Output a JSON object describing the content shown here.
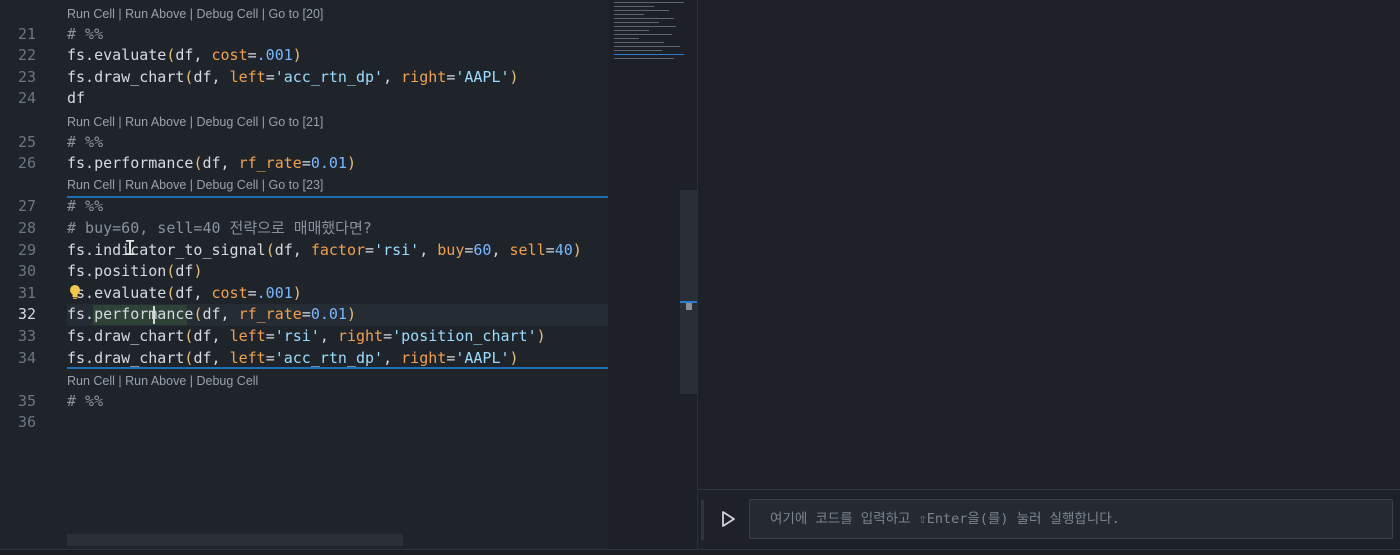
{
  "editor": {
    "lens_groups": [
      {
        "id": "lens-20",
        "text": "Run Cell | Run Above | Debug Cell | Go to [20]"
      },
      {
        "id": "lens-21",
        "text": "Run Cell | Run Above | Debug Cell | Go to [21]"
      },
      {
        "id": "lens-23",
        "text": "Run Cell | Run Above | Debug Cell | Go to [23]"
      },
      {
        "id": "lens-last",
        "text": "Run Cell | Run Above | Debug Cell"
      }
    ],
    "lines": [
      {
        "num": "21",
        "code": "# %%"
      },
      {
        "num": "22",
        "code": "fs.evaluate(df, cost=.001)"
      },
      {
        "num": "23",
        "code": "fs.draw_chart(df, left='acc_rtn_dp', right='AAPL')"
      },
      {
        "num": "24",
        "code": "df"
      },
      {
        "num": "25",
        "code": "# %%"
      },
      {
        "num": "26",
        "code": "fs.performance(df, rf_rate=0.01)"
      },
      {
        "num": "27",
        "code": "# %%"
      },
      {
        "num": "28",
        "code": "# buy=60, sell=40 전략으로 매매했다면?"
      },
      {
        "num": "29",
        "code": "fs.indicator_to_signal(df, factor='rsi', buy=60, sell=40)"
      },
      {
        "num": "30",
        "code": "fs.position(df)"
      },
      {
        "num": "31",
        "code": "fs.evaluate(df, cost=.001)"
      },
      {
        "num": "32",
        "code": "fs.performance(df, rf_rate=0.01)"
      },
      {
        "num": "33",
        "code": "fs.draw_chart(df, left='rsi', right='position_chart')"
      },
      {
        "num": "34",
        "code": "fs.draw_chart(df, left='acc_rtn_dp', right='AAPL')"
      },
      {
        "num": "35",
        "code": "# %%"
      },
      {
        "num": "36",
        "code": ""
      }
    ]
  },
  "repl": {
    "placeholder": "여기에 코드를 입력하고 ⇧Enter을(를) 눌러 실행합니다.",
    "run_icon": "play-icon"
  },
  "colors": {
    "background": "#1f242b",
    "keyword_arg": "#f0a050",
    "string": "#9cdcfe",
    "number": "#79b8ff",
    "paren": "#e5c07b",
    "cell_separator": "#1f6fb8"
  }
}
